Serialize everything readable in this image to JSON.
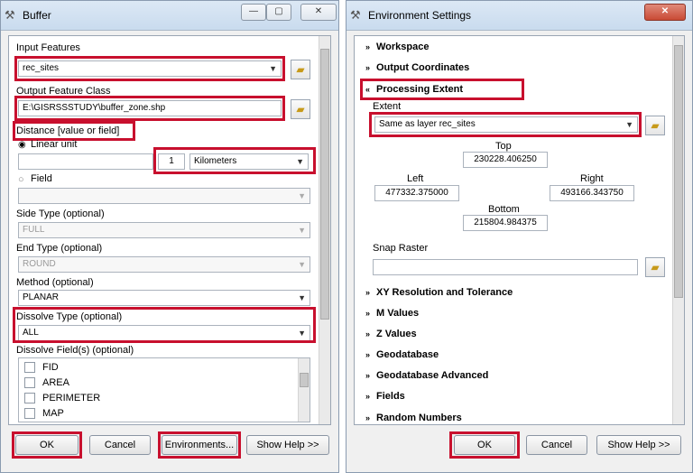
{
  "buffer": {
    "title": "Buffer",
    "input_features": {
      "label": "Input Features",
      "value": "rec_sites"
    },
    "output_class": {
      "label": "Output Feature Class",
      "value": "E:\\GISRSSSTUDY\\buffer_zone.shp"
    },
    "distance": {
      "label": "Distance [value or field]",
      "linear_unit_label": "Linear unit",
      "value": "1",
      "unit": "Kilometers",
      "field_label": "Field"
    },
    "side_type": {
      "label": "Side Type (optional)",
      "value": "FULL"
    },
    "end_type": {
      "label": "End Type (optional)",
      "value": "ROUND"
    },
    "method": {
      "label": "Method (optional)",
      "value": "PLANAR"
    },
    "dissolve_type": {
      "label": "Dissolve Type (optional)",
      "value": "ALL"
    },
    "dissolve_fields": {
      "label": "Dissolve Field(s) (optional)",
      "items": [
        "FID",
        "AREA",
        "PERIMETER",
        "MAP"
      ]
    },
    "buttons": {
      "ok": "OK",
      "cancel": "Cancel",
      "environments": "Environments...",
      "help": "Show Help >>"
    }
  },
  "env": {
    "title": "Environment Settings",
    "sections_top": [
      "Workspace",
      "Output Coordinates",
      "Processing Extent"
    ],
    "extent": {
      "label": "Extent",
      "value": "Same as layer rec_sites",
      "top_label": "Top",
      "top_value": "230228.406250",
      "left_label": "Left",
      "left_value": "477332.375000",
      "right_label": "Right",
      "right_value": "493166.343750",
      "bottom_label": "Bottom",
      "bottom_value": "215804.984375"
    },
    "snap_raster_label": "Snap Raster",
    "sections_bottom": [
      "XY Resolution and Tolerance",
      "M Values",
      "Z Values",
      "Geodatabase",
      "Geodatabase Advanced",
      "Fields",
      "Random Numbers"
    ],
    "buttons": {
      "ok": "OK",
      "cancel": "Cancel",
      "help": "Show Help >>"
    }
  },
  "highlight_color": "#c8102e"
}
